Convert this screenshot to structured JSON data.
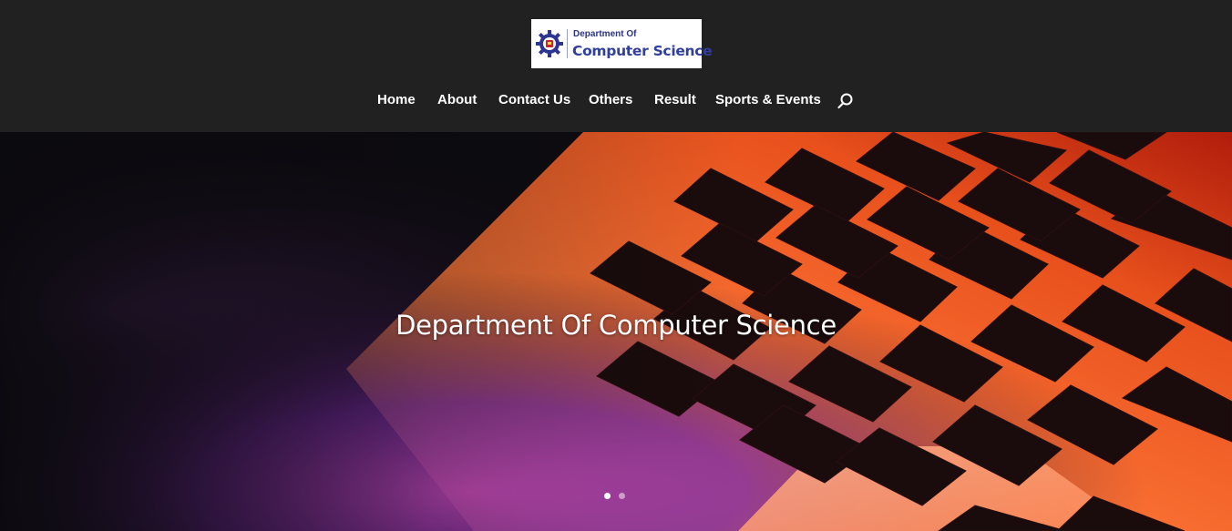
{
  "header": {
    "logo": {
      "line1": "Department Of",
      "line2": "Computer Science",
      "seal_icon": "gear-seal-icon"
    },
    "nav": [
      {
        "label": "Home"
      },
      {
        "label": "About"
      },
      {
        "label": "Contact Us"
      },
      {
        "label": "Others"
      },
      {
        "label": "Result"
      },
      {
        "label": "Sports & Events"
      }
    ],
    "search_icon": "search-icon"
  },
  "hero": {
    "title": "Department Of Computer Science",
    "slides_total": 2,
    "active_slide": 1
  },
  "colors": {
    "header_bg": "#212121",
    "nav_text": "#ffffff",
    "logo_text": "#2f3f9a",
    "hero_orange": "#ff7a2a",
    "hero_purple": "#8a2bb0"
  }
}
